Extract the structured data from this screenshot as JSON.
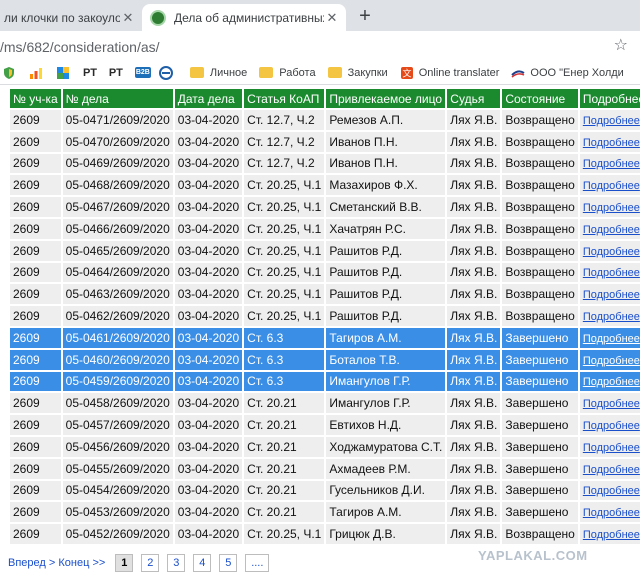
{
  "tabs": [
    {
      "title": "ли клочки по закоулочка",
      "active": false
    },
    {
      "title": "Дела об административных пра",
      "active": true
    }
  ],
  "address_bar": {
    "url": "/ms/682/consideration/as/"
  },
  "bookmarks": [
    {
      "label": "РТ",
      "icon": "rt-icon"
    },
    {
      "label": "РТ",
      "icon": "rt-icon"
    },
    {
      "label": "B2B",
      "icon": "b2b-icon"
    },
    {
      "label": "Личное",
      "icon": "folder-icon"
    },
    {
      "label": "Работа",
      "icon": "folder-icon"
    },
    {
      "label": "Закупки",
      "icon": "folder-icon"
    },
    {
      "label": "Online translater",
      "icon": "translate-icon"
    },
    {
      "label": "ООО \"Енер Холди",
      "icon": "company-icon"
    }
  ],
  "table": {
    "headers": [
      "№ уч-ка",
      "№ дела",
      "Дата дела",
      "Статья КоАП",
      "Привлекаемое лицо",
      "Судья",
      "Состояние",
      "Подробнее"
    ],
    "rows": [
      {
        "c": [
          "2609",
          "05-0471/2609/2020",
          "03-04-2020",
          "Ст. 12.7, Ч.2",
          "Ремезов А.П.",
          "Лях Я.В.",
          "Возвращено",
          "Подробнее"
        ],
        "sel": false
      },
      {
        "c": [
          "2609",
          "05-0470/2609/2020",
          "03-04-2020",
          "Ст. 12.7, Ч.2",
          "Иванов П.Н.",
          "Лях Я.В.",
          "Возвращено",
          "Подробнее"
        ],
        "sel": false
      },
      {
        "c": [
          "2609",
          "05-0469/2609/2020",
          "03-04-2020",
          "Ст. 12.7, Ч.2",
          "Иванов П.Н.",
          "Лях Я.В.",
          "Возвращено",
          "Подробнее"
        ],
        "sel": false
      },
      {
        "c": [
          "2609",
          "05-0468/2609/2020",
          "03-04-2020",
          "Ст. 20.25, Ч.1",
          "Мазахиров Ф.Х.",
          "Лях Я.В.",
          "Возвращено",
          "Подробнее"
        ],
        "sel": false
      },
      {
        "c": [
          "2609",
          "05-0467/2609/2020",
          "03-04-2020",
          "Ст. 20.25, Ч.1",
          "Сметанский В.В.",
          "Лях Я.В.",
          "Возвращено",
          "Подробнее"
        ],
        "sel": false
      },
      {
        "c": [
          "2609",
          "05-0466/2609/2020",
          "03-04-2020",
          "Ст. 20.25, Ч.1",
          "Хачатрян Р.С.",
          "Лях Я.В.",
          "Возвращено",
          "Подробнее"
        ],
        "sel": false
      },
      {
        "c": [
          "2609",
          "05-0465/2609/2020",
          "03-04-2020",
          "Ст. 20.25, Ч.1",
          "Рашитов Р.Д.",
          "Лях Я.В.",
          "Возвращено",
          "Подробнее"
        ],
        "sel": false
      },
      {
        "c": [
          "2609",
          "05-0464/2609/2020",
          "03-04-2020",
          "Ст. 20.25, Ч.1",
          "Рашитов Р.Д.",
          "Лях Я.В.",
          "Возвращено",
          "Подробнее"
        ],
        "sel": false
      },
      {
        "c": [
          "2609",
          "05-0463/2609/2020",
          "03-04-2020",
          "Ст. 20.25, Ч.1",
          "Рашитов Р.Д.",
          "Лях Я.В.",
          "Возвращено",
          "Подробнее"
        ],
        "sel": false
      },
      {
        "c": [
          "2609",
          "05-0462/2609/2020",
          "03-04-2020",
          "Ст. 20.25, Ч.1",
          "Рашитов Р.Д.",
          "Лях Я.В.",
          "Возвращено",
          "Подробнее"
        ],
        "sel": false
      },
      {
        "c": [
          "2609",
          "05-0461/2609/2020",
          "03-04-2020",
          "Ст. 6.3",
          "Тагиров А.М.",
          "Лях Я.В.",
          "Завершено",
          "Подробнее"
        ],
        "sel": true
      },
      {
        "c": [
          "2609",
          "05-0460/2609/2020",
          "03-04-2020",
          "Ст. 6.3",
          "Боталов Т.В.",
          "Лях Я.В.",
          "Завершено",
          "Подробнее"
        ],
        "sel": true
      },
      {
        "c": [
          "2609",
          "05-0459/2609/2020",
          "03-04-2020",
          "Ст. 6.3",
          "Имангулов Г.Р.",
          "Лях Я.В.",
          "Завершено",
          "Подробнее"
        ],
        "sel": true
      },
      {
        "c": [
          "2609",
          "05-0458/2609/2020",
          "03-04-2020",
          "Ст. 20.21",
          "Имангулов Г.Р.",
          "Лях Я.В.",
          "Завершено",
          "Подробнее"
        ],
        "sel": false
      },
      {
        "c": [
          "2609",
          "05-0457/2609/2020",
          "03-04-2020",
          "Ст. 20.21",
          "Евтихов Н.Д.",
          "Лях Я.В.",
          "Завершено",
          "Подробнее"
        ],
        "sel": false
      },
      {
        "c": [
          "2609",
          "05-0456/2609/2020",
          "03-04-2020",
          "Ст. 20.21",
          "Ходжамуратова С.Т.",
          "Лях Я.В.",
          "Завершено",
          "Подробнее"
        ],
        "sel": false
      },
      {
        "c": [
          "2609",
          "05-0455/2609/2020",
          "03-04-2020",
          "Ст. 20.21",
          "Ахмадеев Р.М.",
          "Лях Я.В.",
          "Завершено",
          "Подробнее"
        ],
        "sel": false
      },
      {
        "c": [
          "2609",
          "05-0454/2609/2020",
          "03-04-2020",
          "Ст. 20.21",
          "Гусельников Д.И.",
          "Лях Я.В.",
          "Завершено",
          "Подробнее"
        ],
        "sel": false
      },
      {
        "c": [
          "2609",
          "05-0453/2609/2020",
          "03-04-2020",
          "Ст. 20.21",
          "Тагиров А.М.",
          "Лях Я.В.",
          "Завершено",
          "Подробнее"
        ],
        "sel": false
      },
      {
        "c": [
          "2609",
          "05-0452/2609/2020",
          "03-04-2020",
          "Ст. 20.25, Ч.1",
          "Грицюк Д.В.",
          "Лях Я.В.",
          "Возвращено",
          "Подробнее"
        ],
        "sel": false
      }
    ]
  },
  "pager": {
    "forward": "Вперед",
    "end": "Конец >>",
    "separator": ">",
    "pages": [
      "1",
      "2",
      "3",
      "4",
      "5",
      "...."
    ],
    "current": "1"
  },
  "watermark": "YAPLAKAL.COM",
  "colors": {
    "header_green": "#1b8a2e",
    "selection_blue": "#3a8ee6",
    "link_blue": "#1a4fcc",
    "row_gray": "#eeeeee"
  }
}
